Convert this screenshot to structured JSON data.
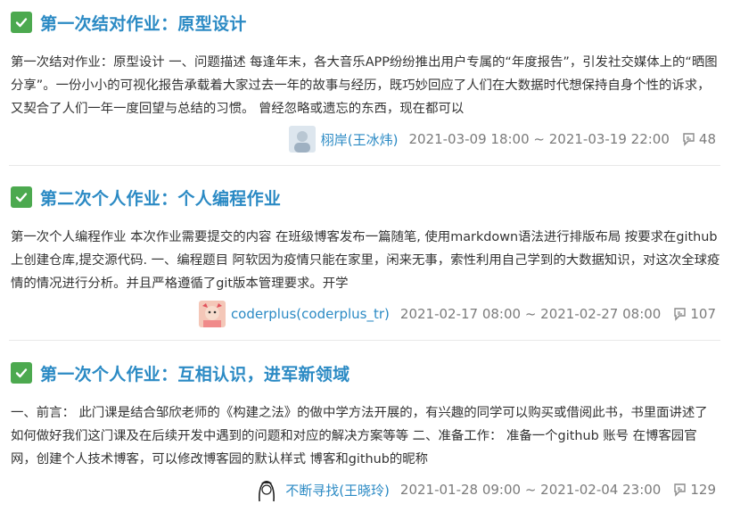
{
  "items": [
    {
      "title": "第一次结对作业：原型设计",
      "summary": "第一次结对作业：原型设计 一、问题描述 每逢年末，各大音乐APP纷纷推出用户专属的“年度报告”，引发社交媒体上的“晒图分享”。一份小小的可视化报告承载着大家过去一年的故事与经历，既巧妙回应了人们在大数据时代想保持自身个性的诉求，又契合了人们一年一度回望与总结的习惯。 曾经忽略或遗忘的东西，现在都可以",
      "author": "栩岸(王冰炜)",
      "dates": "2021-03-09 18:00 ~ 2021-03-19 22:00",
      "count": "48"
    },
    {
      "title": "第二次个人作业：个人编程作业",
      "summary": "第一次个人编程作业 本次作业需要提交的内容 在班级博客发布一篇随笔, 使用markdown语法进行排版布局 按要求在github上创建仓库,提交源代码. 一、编程题目 阿软因为疫情只能在家里，闲来无事，索性利用自己学到的大数据知识，对这次全球疫情的情况进行分析。并且严格遵循了git版本管理要求。开学",
      "author": "coderplus(coderplus_tr)",
      "dates": "2021-02-17 08:00 ~ 2021-02-27 08:00",
      "count": "107"
    },
    {
      "title": "第一次个人作业：互相认识，进军新领域",
      "summary": "一、前言： 此门课是结合邹欣老师的《构建之法》的做中学方法开展的，有兴趣的同学可以购买或借阅此书，书里面讲述了如何做好我们这门课及在后续开发中遇到的问题和对应的解决方案等等 二、准备工作： 准备一个github 账号 在博客园官网，创建个人技术博客，可以修改博客园的默认样式 博客和github的昵称",
      "author": "不断寻找(王晓玲)",
      "dates": "2021-01-28 09:00 ~ 2021-02-04 23:00",
      "count": "129"
    }
  ],
  "colors": {
    "accent": "#2b8ac4",
    "check": "#4ca94f",
    "meta": "#7b7b7b"
  },
  "icons": {
    "status": "check-icon",
    "count": "comment-icon"
  }
}
